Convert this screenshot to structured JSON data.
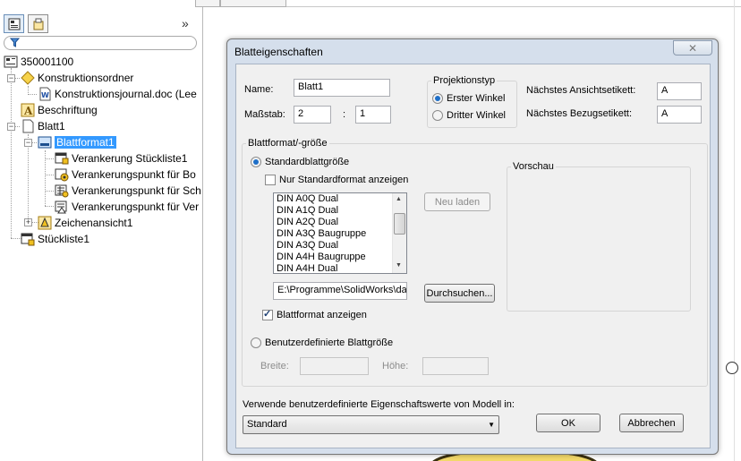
{
  "left_panel": {
    "tabs": [
      "feature-manager-icon",
      "property-manager-icon"
    ],
    "collapse_symbol": "»",
    "filter_icon": "filter-icon",
    "tree": [
      {
        "label": "350001100",
        "icon": "drawing-icon"
      },
      {
        "label": "Konstruktionsordner",
        "icon": "design-binder-icon"
      },
      {
        "label": "Konstruktionsjournal.doc (Lee",
        "icon": "word-document-icon"
      },
      {
        "label": "Beschriftung",
        "icon": "annotation-icon"
      },
      {
        "label": "Blatt1",
        "icon": "sheet-icon"
      },
      {
        "label": "Blattformat1",
        "icon": "sheet-format-icon"
      },
      {
        "label": "Verankerung Stückliste1",
        "icon": "anchor-icon"
      },
      {
        "label": "Verankerungspunkt für Bo",
        "icon": "anchor-icon"
      },
      {
        "label": "Verankerungspunkt für Sch",
        "icon": "anchor-icon"
      },
      {
        "label": "Verankerungspunkt für Ver",
        "icon": "anchor-icon"
      },
      {
        "label": "Zeichenansicht1",
        "icon": "drawing-view-icon"
      },
      {
        "label": "Stückliste1",
        "icon": "bom-table-icon"
      }
    ]
  },
  "dialog": {
    "title": "Blatteigenschaften",
    "close_symbol": "✕",
    "name_label": "Name:",
    "name_value": "Blatt1",
    "scale_label": "Maßstab:",
    "scale_num": "2",
    "scale_sep": ":",
    "scale_den": "1",
    "projection": {
      "title": "Projektionstyp",
      "first_angle": "Erster Winkel",
      "third_angle": "Dritter Winkel",
      "selected": "Erster Winkel"
    },
    "next_view_label": "Nächstes Ansichtsetikett:",
    "next_view_value": "A",
    "next_datum_label": "Nächstes Bezugsetikett:",
    "next_datum_value": "A",
    "format_group": {
      "title": "Blattformat/-größe",
      "standard_label": "Standardblattgröße",
      "standard_selected": true,
      "only_standard_label": "Nur Standardformat anzeigen",
      "only_standard_checked": false,
      "list_items": [
        "DIN A0Q Dual",
        "DIN A1Q Dual",
        "DIN A2Q Dual",
        "DIN A3Q Baugruppe",
        "DIN A3Q Dual",
        "DIN A4H Baugruppe",
        "DIN A4H Dual"
      ],
      "reload_label": "Neu laden",
      "path_value": "E:\\Programme\\SolidWorks\\da",
      "browse_label": "Durchsuchen...",
      "show_format_label": "Blattformat anzeigen",
      "show_format_checked": true,
      "custom_label": "Benutzerdefinierte Blattgröße",
      "width_label": "Breite:",
      "height_label": "Höhe:",
      "preview_title": "Vorschau"
    },
    "custom_props_label": "Verwende benutzerdefinierte Eigenschaftswerte von Modell in:",
    "custom_props_value": "Standard",
    "ok_label": "OK",
    "cancel_label": "Abbrechen"
  }
}
